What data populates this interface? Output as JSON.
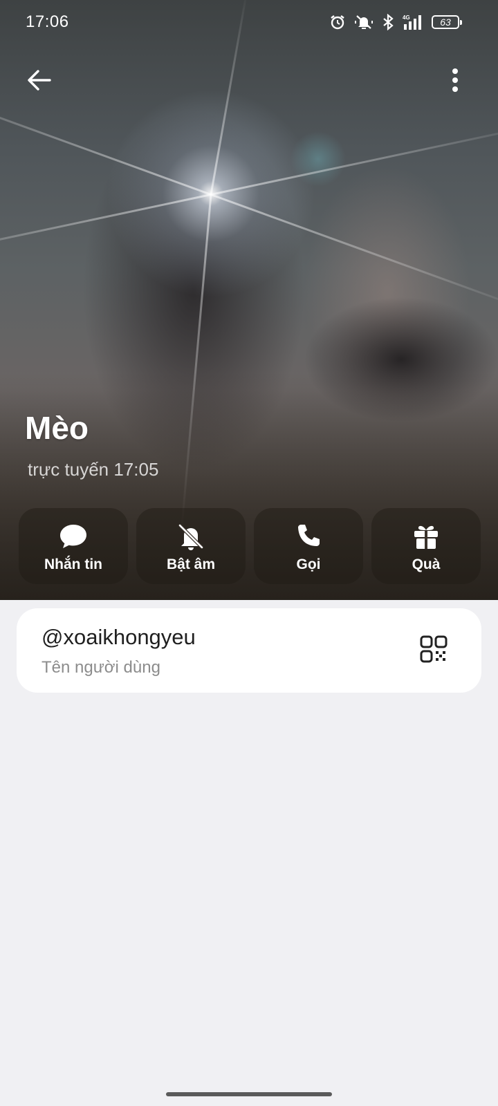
{
  "status_bar": {
    "time": "17:06",
    "battery": "63",
    "icons": [
      "alarm-icon",
      "vibrate-off-icon",
      "bluetooth-icon",
      "signal-4g-icon",
      "battery-icon"
    ]
  },
  "header": {
    "back_icon": "arrow-left-icon",
    "more_icon": "more-vertical-icon"
  },
  "profile": {
    "name": "Mèo",
    "status": "trực tuyến 17:05"
  },
  "actions": [
    {
      "label": "Nhắn tin",
      "icon": "chat-bubble-icon"
    },
    {
      "label": "Bật âm",
      "icon": "bell-off-icon"
    },
    {
      "label": "Gọi",
      "icon": "phone-icon"
    },
    {
      "label": "Quà",
      "icon": "gift-icon"
    }
  ],
  "username_card": {
    "username": "@xoaikhongyeu",
    "caption": "Tên người dùng",
    "qr_icon": "qr-code-icon"
  },
  "colors": {
    "background": "#f0f0f3",
    "card": "#ffffff",
    "action_bg": "rgba(32,26,20,0.45)"
  }
}
